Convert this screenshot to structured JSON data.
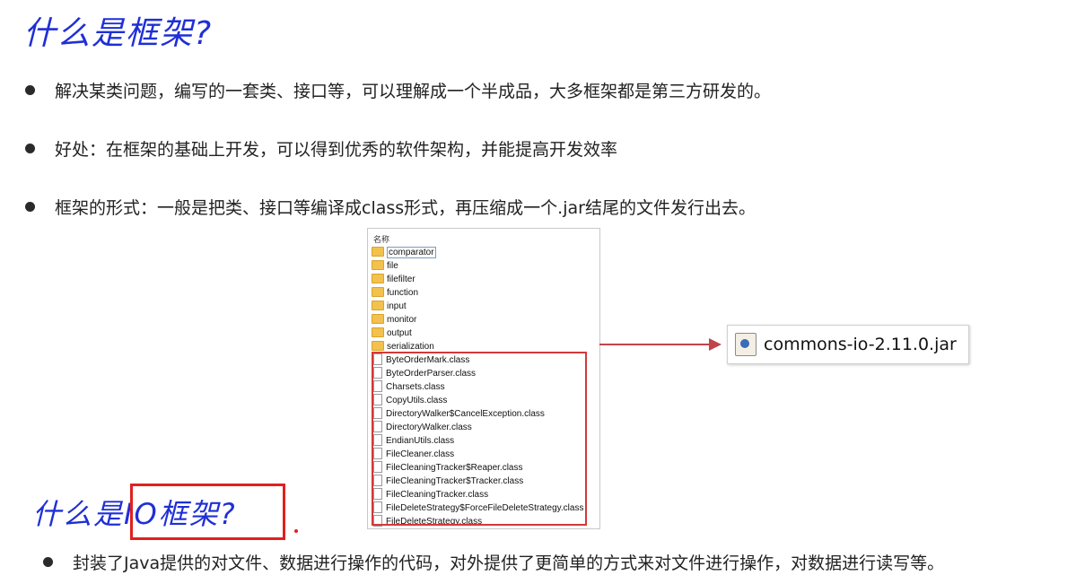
{
  "title": "什么是框架?",
  "bullets": [
    "解决某类问题，编写的一套类、接口等，可以理解成一个半成品，大多框架都是第三方研发的。",
    "好处：在框架的基础上开发，可以得到优秀的软件架构，并能提高开发效率",
    "框架的形式：一般是把类、接口等编译成class形式，再压缩成一个.jar结尾的文件发行出去。"
  ],
  "explorer": {
    "header": "名称",
    "folders": [
      "comparator",
      "file",
      "filefilter",
      "function",
      "input",
      "monitor",
      "output",
      "serialization"
    ],
    "files": [
      "ByteOrderMark.class",
      "ByteOrderParser.class",
      "Charsets.class",
      "CopyUtils.class",
      "DirectoryWalker$CancelException.class",
      "DirectoryWalker.class",
      "EndianUtils.class",
      "FileCleaner.class",
      "FileCleaningTracker$Reaper.class",
      "FileCleaningTracker$Tracker.class",
      "FileCleaningTracker.class",
      "FileDeleteStrategy$ForceFileDeleteStrategy.class",
      "FileDeleteStrategy.class"
    ]
  },
  "jar": {
    "filename": "commons-io-2.11.0.jar",
    "icon": "java-jar-icon"
  },
  "subtitle": {
    "prefix": "什么是",
    "highlight": "IO框架?"
  },
  "bullet4": "封装了Java提供的对文件、数据进行操作的代码，对外提供了更简单的方式来对文件进行操作，对数据进行读写等。",
  "colors": {
    "handwriting_blue": "#1f2fd6",
    "highlight_red": "#e0201e",
    "arrow_red": "#c0454a"
  }
}
